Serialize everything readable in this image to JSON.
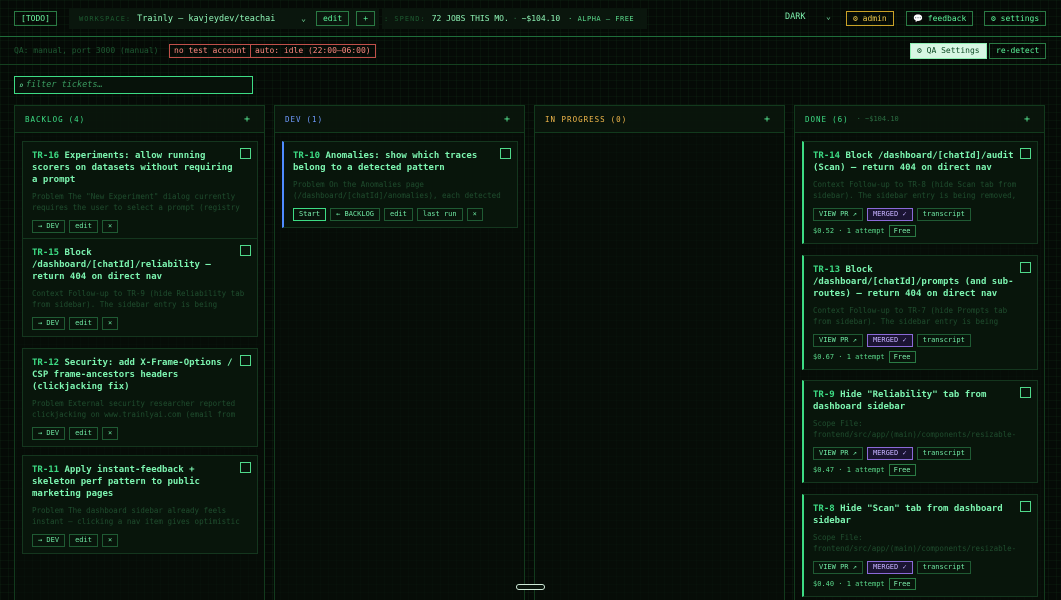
{
  "topbar": {
    "todo_label": "[TODO]",
    "workspace_label": "WORKSPACE:",
    "workspace_value": "Trainly — kavjeydev/teachai",
    "edit_label": "edit",
    "add_label": "+",
    "spend_label": ": SPEND:",
    "spend_jobs": "72 JOBS THIS MO.",
    "spend_amount": "~$104.10",
    "spend_plan": "· ALPHA — FREE",
    "theme_value": "DARK",
    "admin_label": "⚙ admin",
    "feedback_label": "💬 feedback",
    "settings_label": "⚙ settings"
  },
  "qabar": {
    "qa_text": "QA: manual, port 3000 (manual)",
    "no_test_account": "no test account",
    "auto_status": "auto: idle (22:00–06:00)",
    "qa_settings_label": "⚙ QA Settings",
    "redetect_label": "re-detect"
  },
  "filter": {
    "placeholder": "filter tickets…"
  },
  "columns": [
    {
      "title": "BACKLOG",
      "count": "(4)",
      "extra": "",
      "color": "#3ddc84",
      "cards": [
        {
          "id": "TR-16",
          "title": "Experiments: allow running scorers on datasets without requiring a prompt",
          "desc1": "Problem The \"New Experiment\" dialog currently",
          "desc2": "requires the user to select a prompt (registry",
          "actions": [
            "→ DEV",
            "edit",
            "×"
          ]
        },
        {
          "id": "TR-15",
          "title": "Block /dashboard/[chatId]/reliability — return 404 on direct nav",
          "desc1": "Context Follow-up to TR-9 (hide Reliability tab",
          "desc2": "from sidebar). The sidebar entry is being",
          "actions": [
            "→ DEV",
            "edit",
            "×"
          ]
        },
        {
          "id": "TR-12",
          "title": "Security: add X-Frame-Options / CSP frame-ancestors headers (clickjacking fix)",
          "desc1": "Problem External security researcher reported",
          "desc2": "clickjacking on www.trainlyai.com (email from",
          "actions": [
            "→ DEV",
            "edit",
            "×"
          ]
        },
        {
          "id": "TR-11",
          "title": "Apply instant-feedback + skeleton perf pattern to public marketing pages",
          "desc1": "Problem The dashboard sidebar already feels",
          "desc2": "instant — clicking a nav item gives optimistic",
          "actions": [
            "→ DEV",
            "edit",
            "×"
          ]
        }
      ]
    },
    {
      "title": "DEV",
      "count": "(1)",
      "extra": "",
      "color": "#6f9bff",
      "cards": [
        {
          "id": "TR-10",
          "title": "Anomalies: show which traces belong to a detected pattern",
          "desc1": "Problem On the Anomalies page",
          "desc2": "(/dashboard/[chatId]/anomalies), each detected",
          "actions": [
            "Start",
            "← BACKLOG",
            "edit",
            "last run",
            "×"
          ]
        }
      ]
    },
    {
      "title": "IN PROGRESS",
      "count": "(0)",
      "extra": "",
      "color": "#f2b84b",
      "cards": []
    },
    {
      "title": "DONE",
      "count": "(6)",
      "extra": "· ~$104.10",
      "color": "#3ddc84",
      "cards": [
        {
          "id": "TR-14",
          "title": "Block /dashboard/[chatId]/audit (Scan) — return 404 on direct nav",
          "desc1": "Context Follow-up to TR-8 (hide Scan tab from",
          "desc2": "sidebar). The sidebar entry is being removed,",
          "actions": [
            "VIEW PR ↗",
            "MERGED ✓",
            "transcript"
          ],
          "cost": "$0.52 · 1 attempt",
          "badge": "Free"
        },
        {
          "id": "TR-13",
          "title": "Block /dashboard/[chatId]/prompts (and sub-routes) — return 404 on direct nav",
          "desc1": "Context Follow-up to TR-7 (hide Prompts tab",
          "desc2": "from sidebar). The sidebar entry is being",
          "actions": [
            "VIEW PR ↗",
            "MERGED ✓",
            "transcript"
          ],
          "cost": "$0.67 · 1 attempt",
          "badge": "Free"
        },
        {
          "id": "TR-9",
          "title": "Hide \"Reliability\" tab from dashboard sidebar",
          "desc1": "Scope File:",
          "desc2": "frontend/src/app/(main)/components/resizable-",
          "actions": [
            "VIEW PR ↗",
            "MERGED ✓",
            "transcript"
          ],
          "cost": "$0.47 · 1 attempt",
          "badge": "Free"
        },
        {
          "id": "TR-8",
          "title": "Hide \"Scan\" tab from dashboard sidebar",
          "desc1": "Scope File:",
          "desc2": "frontend/src/app/(main)/components/resizable-",
          "actions": [
            "VIEW PR ↗",
            "MERGED ✓",
            "transcript"
          ],
          "cost": "$0.40 · 1 attempt",
          "badge": "Free"
        }
      ]
    }
  ]
}
